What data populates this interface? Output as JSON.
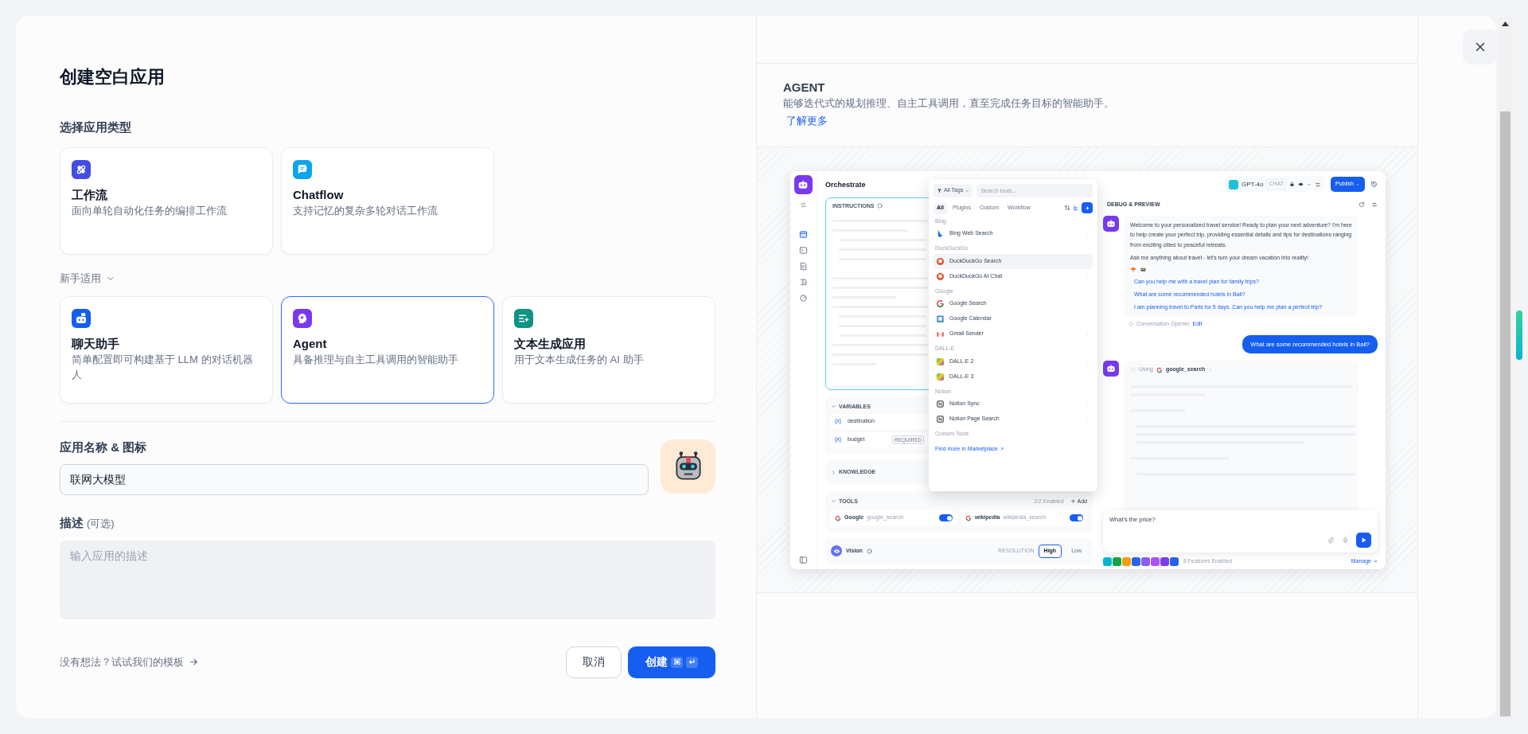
{
  "dialog": {
    "title": "创建空白应用",
    "type_section": "选择应用类型",
    "app_types": [
      {
        "kind": "workflow",
        "name": "工作流",
        "description": "面向单轮自动化任务的编排工作流",
        "color": "#444ce7",
        "selected": false
      },
      {
        "kind": "chatflow",
        "name": "Chatflow",
        "description": "支持记忆的复杂多轮对话工作流",
        "color": "#0ba5ec",
        "selected": false
      }
    ],
    "beginner_section": "新手适用",
    "beginner_types": [
      {
        "kind": "chatbot",
        "name": "聊天助手",
        "description": "简单配置即可构建基于 LLM 的对话机器人",
        "color": "#155eef",
        "selected": false
      },
      {
        "kind": "agent",
        "name": "Agent",
        "description": "具备推理与自主工具调用的智能助手",
        "color": "#7839ee",
        "selected": true
      },
      {
        "kind": "completion",
        "name": "文本生成应用",
        "description": "用于文本生成任务的 AI 助手",
        "color": "#0e9384",
        "selected": false
      }
    ],
    "name_label": "应用名称 & 图标",
    "name_value": "联网大模型",
    "description_label": "描述",
    "description_optional": "(可选)",
    "description_placeholder": "输入应用的描述",
    "template_link": "没有想法？试试我们的模板",
    "cancel": "取消",
    "create": "创建",
    "create_keys": [
      "⌘",
      "↵"
    ]
  },
  "preview": {
    "title": "AGENT",
    "description": "能够迭代式的规划推理、自主工具调用，直至完成任务目标的智能助手。",
    "learn_more": "了解更多",
    "orchestrate": {
      "title": "Orchestrate",
      "instructions": "INSTRUCTIONS",
      "variables_title": "VARIABLES",
      "variables": [
        {
          "prefix": "{x}",
          "name": "destination"
        },
        {
          "prefix": "{x}",
          "name": "budget",
          "badge": "REQUIRED"
        }
      ],
      "knowledge_title": "KNOWLEDGE",
      "tools_title": "TOOLS",
      "tools_enabled": "2/2 Enabled",
      "add": "Add",
      "tools": [
        {
          "name": "Google",
          "tool_id": "google_search",
          "on": true
        },
        {
          "name": "wikipedia",
          "tool_id": "wikipedia_search",
          "on": true
        }
      ],
      "vision": "Vision",
      "resolution": "RESOLUTION",
      "resolutions": [
        {
          "label": "High",
          "selected": true
        },
        {
          "label": "Low",
          "selected": false
        }
      ]
    },
    "tool_picker": {
      "filter": "All Tags",
      "search_placeholder": "Search tools...",
      "tabs": [
        {
          "label": "All",
          "selected": true
        },
        {
          "label": "Plugins",
          "selected": false
        },
        {
          "label": "Custom",
          "selected": false
        },
        {
          "label": "Workflow",
          "selected": false
        }
      ],
      "groups": [
        {
          "name": "Bing",
          "items": [
            {
              "kind": "bing",
              "name": "Bing Web Search",
              "selected": false
            }
          ]
        },
        {
          "name": "DuckDuckGo",
          "items": [
            {
              "kind": "duckduckgo",
              "name": "DuckDuckGo Search",
              "selected": true
            },
            {
              "kind": "duckduckgo",
              "name": "DuckDuckGo AI Chat",
              "selected": false
            }
          ]
        },
        {
          "name": "Google",
          "items": [
            {
              "kind": "google",
              "name": "Google Search",
              "selected": false
            },
            {
              "kind": "calendar",
              "name": "Google Calendar",
              "selected": false
            },
            {
              "kind": "mail",
              "name": "Gmail Sender",
              "selected": false
            }
          ]
        },
        {
          "name": "DALL-E",
          "items": [
            {
              "kind": "dalle",
              "name": "DALL-E 2",
              "selected": false
            },
            {
              "kind": "dalle",
              "name": "DALL-E 3",
              "selected": false
            }
          ]
        },
        {
          "name": "Notion",
          "items": [
            {
              "kind": "notion",
              "name": "Notion Sync",
              "selected": false
            },
            {
              "kind": "notion",
              "name": "Notion Page Search",
              "selected": false
            }
          ]
        },
        {
          "name": "Custom Tools"
        }
      ],
      "footer_link": "Find more in Marketplace"
    },
    "debug": {
      "model": "GPT-4o",
      "model_mode": "CHAT",
      "publish": "Publish",
      "title": "DEBUG & PREVIEW",
      "messages": [
        {
          "kind": "bot",
          "paragraphs": [
            "Welcome to your personalized travel service! Ready to plan your next adventure? I'm here to help create your perfect trip, providing essential details and tips for destinations ranging from exciting cities to peaceful retreats.",
            "Ask me anything about travel - let's turn your dream vacation into reality!"
          ],
          "suggestions": [
            "Can you help me with a travel plan for family trips?",
            "What are some recommended hotels in Bali?",
            "I am planning travel to Paris for 5 days. Can you help me plan a perfect trip?"
          ],
          "opener_label": "Conversation Opener",
          "opener_edit": "Edit"
        },
        {
          "kind": "user",
          "text": "What are some recommended hotels in Bali?"
        },
        {
          "kind": "tool",
          "label": "Using",
          "tool": "google_search"
        }
      ],
      "input_value": "What's the price?",
      "features": "8 Features Enabled",
      "manage": "Manage"
    }
  }
}
